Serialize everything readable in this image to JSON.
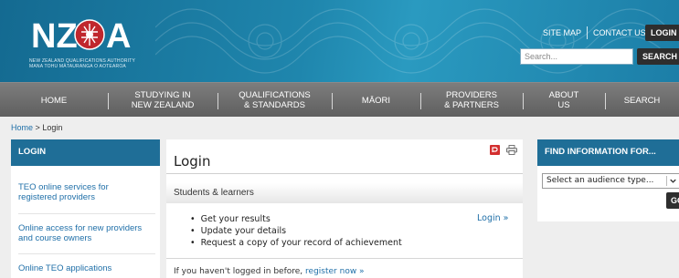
{
  "header": {
    "logo_text": "NZQA",
    "logo_subtitle_1": "NEW ZEALAND QUALIFICATIONS AUTHORITY",
    "logo_subtitle_2": "MANA TOHU MĀTAURANGA O AOTEAROA",
    "site_map": "SITE MAP",
    "contact_us": "CONTACT US",
    "login_button": "LOGIN",
    "search_placeholder": "Search...",
    "search_button": "SEARCH",
    "colors": {
      "header_blue": "#1f86ad",
      "dark_button": "#2e2e2e",
      "logo_red": "#c0272d"
    }
  },
  "nav": {
    "items": [
      {
        "label": "HOME"
      },
      {
        "label": "STUDYING IN\nNEW ZEALAND"
      },
      {
        "label": "QUALIFICATIONS\n& STANDARDS"
      },
      {
        "label": "MĀORI"
      },
      {
        "label": "PROVIDERS\n& PARTNERS"
      },
      {
        "label": "ABOUT\nUS"
      },
      {
        "label": "SEARCH"
      }
    ]
  },
  "breadcrumb": {
    "home": "Home",
    "separator": ">",
    "current": "Login"
  },
  "left_sidebar": {
    "heading": "LOGIN",
    "links": [
      {
        "label": "TEO online services for\nregistered providers"
      },
      {
        "label": "Online access for new providers\nand course owners"
      },
      {
        "label": "Online TEO applications"
      }
    ]
  },
  "main": {
    "title": "Login",
    "pdf_icon": "pdf-icon",
    "print_icon": "print-icon",
    "audience_title": "Students & learners",
    "items": [
      "Get your results",
      "Update your details",
      "Request a copy of your record of achievement"
    ],
    "login_link": "Login »",
    "register_text": "If you haven't logged in before,",
    "register_link": "register now »"
  },
  "right_sidebar": {
    "heading": "FIND INFORMATION FOR...",
    "select_value": "Select an audience type...",
    "go_button": "GO"
  }
}
